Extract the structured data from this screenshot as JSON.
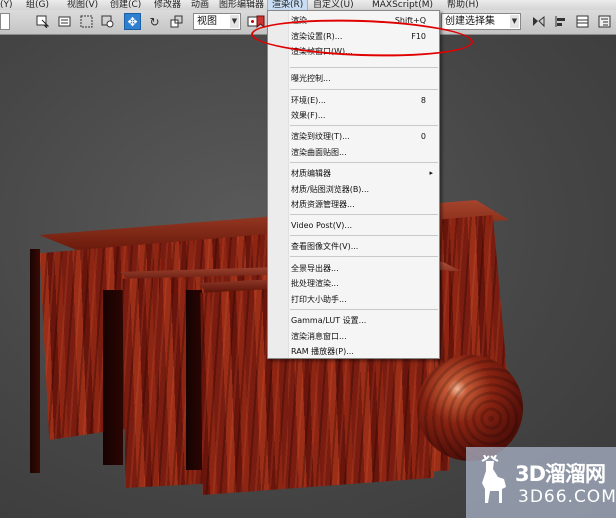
{
  "menubar": {
    "items": [
      {
        "label": "(Y)"
      },
      {
        "label": "组(G)"
      },
      {
        "label": "视图(V)"
      },
      {
        "label": "创建(C)"
      },
      {
        "label": "修改器"
      },
      {
        "label": "动画"
      },
      {
        "label": "图形编辑器"
      },
      {
        "label": "渲染(R)"
      },
      {
        "label": "自定义(U)"
      },
      {
        "label": "MAXScript(M)"
      },
      {
        "label": "帮助(H)"
      }
    ]
  },
  "toolbar": {
    "view_dropdown": "视图",
    "selection_set_dropdown": "创建选择集"
  },
  "render_menu": {
    "items": [
      {
        "label": "渲染",
        "shortcut": "Shift+Q"
      },
      {
        "label": "渲染设置(R)...",
        "shortcut": "F10"
      },
      {
        "label": "渲染帧窗口(W)...",
        "shortcut": ""
      },
      {
        "label": "曝光控制...",
        "shortcut": ""
      },
      {
        "label": "环境(E)...",
        "shortcut": "8"
      },
      {
        "label": "效果(F)...",
        "shortcut": ""
      },
      {
        "label": "渲染到纹理(T)...",
        "shortcut": "0"
      },
      {
        "label": "渲染曲面贴图...",
        "shortcut": ""
      },
      {
        "label": "材质编辑器",
        "shortcut": "",
        "submenu": true
      },
      {
        "label": "材质/贴图浏览器(B)...",
        "shortcut": ""
      },
      {
        "label": "材质资源管理器...",
        "shortcut": ""
      },
      {
        "label": "Video Post(V)...",
        "shortcut": ""
      },
      {
        "label": "查看图像文件(V)...",
        "shortcut": ""
      },
      {
        "label": "全景导出器...",
        "shortcut": ""
      },
      {
        "label": "批处理渲染...",
        "shortcut": ""
      },
      {
        "label": "打印大小助手...",
        "shortcut": ""
      },
      {
        "label": "Gamma/LUT 设置...",
        "shortcut": ""
      },
      {
        "label": "渲染消息窗口...",
        "shortcut": ""
      },
      {
        "label": "RAM 播放器(P)...",
        "shortcut": ""
      }
    ],
    "submenu_arrow": "▸"
  },
  "annotation": {
    "color": "#e00000",
    "highlighted_item": "渲染设置(R)..."
  },
  "watermark": {
    "title": "3D溜溜网",
    "subtitle": "3D66.COM",
    "logo_icon": "deer-icon"
  },
  "colors": {
    "accent": "#2f80d0",
    "viewport": "#4a4a4a",
    "wood": "#8e2412"
  }
}
